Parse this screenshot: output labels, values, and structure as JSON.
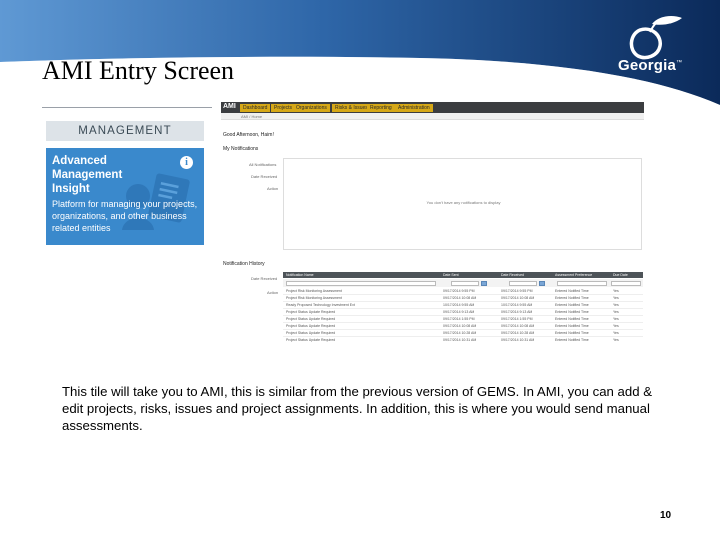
{
  "slide": {
    "title": "AMI Entry Screen",
    "body": "This tile will take you to AMI, this is similar from the previous version of GEMS.  In AMI, you can add & edit projects, risks, issues and project assignments.  In addition, this is where you would send manual assessments.",
    "page_number": "10"
  },
  "logo": {
    "text": "Georgia",
    "trademark": "™",
    "icon": "peach-icon"
  },
  "tile": {
    "header": "MANAGEMENT",
    "title": "Advanced\nManagement\nInsight",
    "description": "Platform for managing your projects, organizations, and other business related entities",
    "info_icon": "info-icon",
    "info_glyph": "i"
  },
  "ami": {
    "app_label": "AMI",
    "nav_items": [
      "Dashboard",
      "Projects",
      "Organizations",
      "Risks & Issues",
      "Reporting",
      "Administration"
    ],
    "breadcrumb": "AMI / Home",
    "greeting": "Good Afternoon, Haim!",
    "notifications_title": "My Notifications",
    "notification_filters": [
      "All Notifications",
      "Date Received",
      "Action"
    ],
    "empty_message": "You don't have any notifications to display",
    "history_title": "Notification History",
    "history_filters": [
      "Date Received",
      "Action"
    ],
    "history_columns": [
      "Notification Name",
      "Date Sent",
      "Date Received",
      "Assessment Preference",
      "Due Date"
    ],
    "history_rows": [
      [
        "Project Risk Monitoring Assessment",
        "09/17/2014 9:55 PM",
        "09/17/2014 9:55 PM",
        "Entered Notified Time",
        "Yes"
      ],
      [
        "Project Risk Monitoring Assessment",
        "09/17/2014 10:08 AM",
        "09/17/2014 10:08 AM",
        "Entered Notified Time",
        "Yes"
      ],
      [
        "Ready Proposed Technology Investment Ext",
        "10/17/2014 9:55 AM",
        "10/17/2014 9:55 AM",
        "Entered Notified Time",
        "Yes"
      ],
      [
        "Project Status Update Required",
        "09/17/2014 9:13 AM",
        "09/17/2014 9:13 AM",
        "Entered Notified Time",
        "Yes"
      ],
      [
        "Project Status Update Required",
        "09/17/2014 1:55 PM",
        "09/17/2014 1:55 PM",
        "Entered Notified Time",
        "Yes"
      ],
      [
        "Project Status Update Required",
        "09/17/2014 10:08 AM",
        "09/17/2014 10:08 AM",
        "Entered Notified Time",
        "Yes"
      ],
      [
        "Project Status Update Required",
        "09/17/2014 10:28 AM",
        "09/17/2014 10:28 AM",
        "Entered Notified Time",
        "Yes"
      ],
      [
        "Project Status Update Required",
        "09/17/2014 10:31 AM",
        "09/17/2014 10:31 AM",
        "Entered Notified Time",
        "Yes"
      ]
    ],
    "colors": {
      "nav_bar": "#3b3d40",
      "nav_highlight": "#d6a817",
      "table_header": "#4d5358"
    }
  },
  "colors": {
    "header_gradient_start": "#0b2a5a",
    "header_gradient_end": "#4f8ec9",
    "tile_blue": "#3a89cc",
    "tile_header_bg": "#dde3e8"
  }
}
